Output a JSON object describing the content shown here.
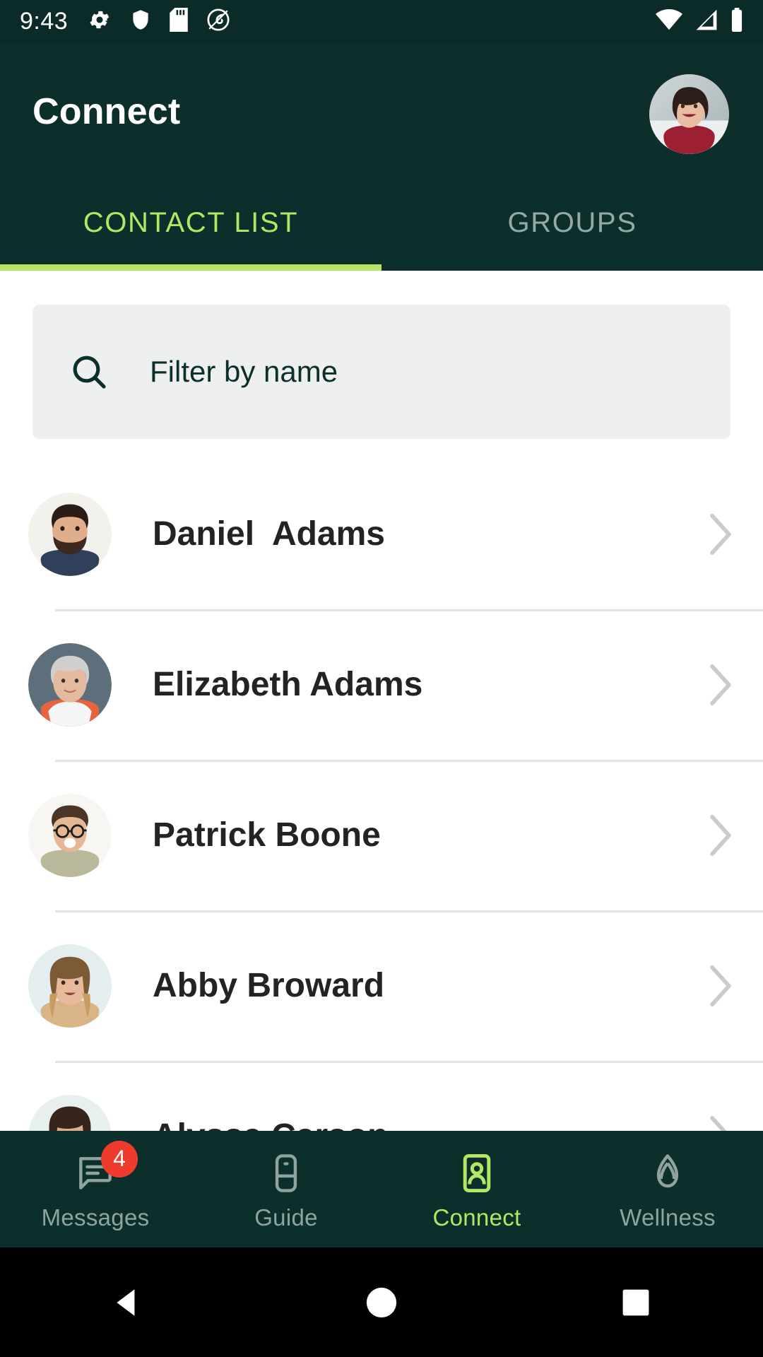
{
  "status_bar": {
    "time": "9:43",
    "left_icons": [
      "gear-icon",
      "shield-icon",
      "sd-card-icon",
      "spiral-icon"
    ],
    "right_icons": [
      "wifi-icon",
      "cell-signal-icon",
      "battery-icon"
    ]
  },
  "app_bar": {
    "title": "Connect",
    "avatar_name": "profile-avatar"
  },
  "tabs": [
    {
      "label": "CONTACT LIST",
      "active": true
    },
    {
      "label": "GROUPS",
      "active": false
    }
  ],
  "search": {
    "placeholder": "Filter by name",
    "value": "",
    "icon": "search-icon"
  },
  "contacts": [
    {
      "name": "Daniel  Adams",
      "avatar": "daniel-adams-avatar"
    },
    {
      "name": "Elizabeth Adams",
      "avatar": "elizabeth-adams-avatar"
    },
    {
      "name": "Patrick Boone",
      "avatar": "patrick-boone-avatar"
    },
    {
      "name": "Abby Broward",
      "avatar": "abby-broward-avatar"
    },
    {
      "name": "Alyssa Carson",
      "avatar": "alyssa-carson-avatar"
    }
  ],
  "bottom_nav": [
    {
      "label": "Messages",
      "icon": "messages-icon",
      "badge": "4",
      "active": false
    },
    {
      "label": "Guide",
      "icon": "guide-icon",
      "badge": null,
      "active": false
    },
    {
      "label": "Connect",
      "icon": "connect-icon",
      "badge": null,
      "active": true
    },
    {
      "label": "Wellness",
      "icon": "wellness-icon",
      "badge": null,
      "active": false
    }
  ],
  "system_nav": [
    "back-button",
    "home-button",
    "recents-button"
  ],
  "colors": {
    "header_bg": "#0d2f2b",
    "status_bg": "#0b2b28",
    "accent_green": "#b5e563",
    "inactive_gray": "#8fa3a0",
    "badge_red": "#ef3b2d",
    "search_bg": "#eef0ef",
    "name_text": "#232323"
  }
}
